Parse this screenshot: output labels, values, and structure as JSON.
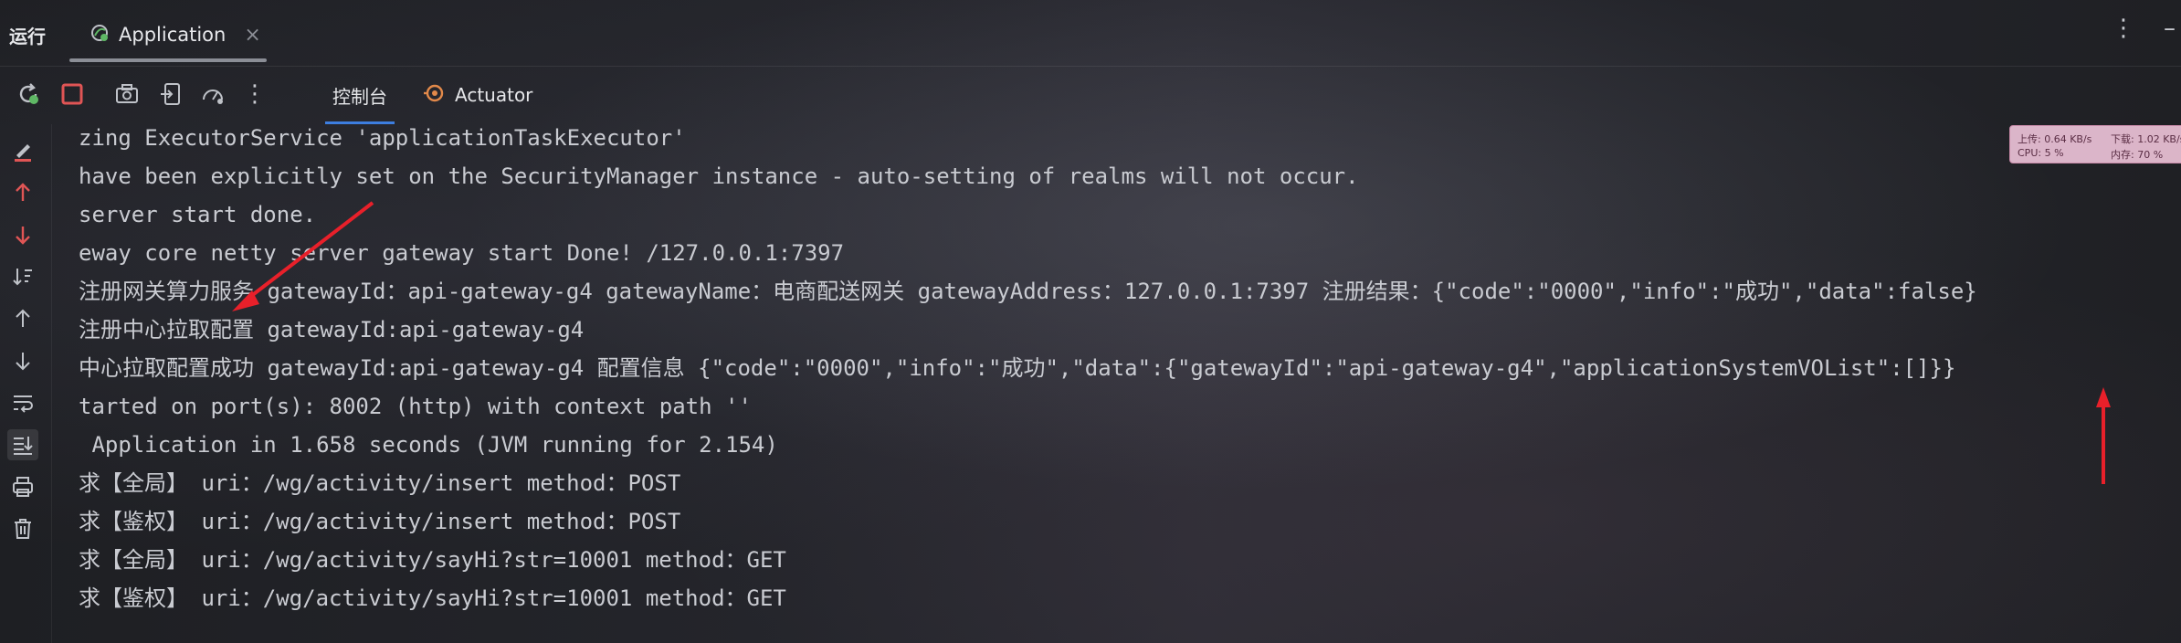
{
  "run_panel": {
    "title": "运行",
    "tab_label": "Application"
  },
  "toolbar": {
    "console_tab": "控制台",
    "actuator_tab": "Actuator"
  },
  "console": {
    "lines": [
      "zing ExecutorService 'applicationTaskExecutor'",
      "have been explicitly set on the SecurityManager instance - auto-setting of realms will not occur.",
      "server start done.",
      "eway core netty server gateway start Done! /127.0.0.1:7397",
      "注册网关算力服务 gatewayId：api-gateway-g4 gatewayName：电商配送网关 gatewayAddress：127.0.0.1:7397 注册结果：{\"code\":\"0000\",\"info\":\"成功\",\"data\":false}",
      "注册中心拉取配置 gatewayId:api-gateway-g4",
      "中心拉取配置成功 gatewayId:api-gateway-g4 配置信息 {\"code\":\"0000\",\"info\":\"成功\",\"data\":{\"gatewayId\":\"api-gateway-g4\",\"applicationSystemVOList\":[]}}",
      "tarted on port(s): 8002 (http) with context path ''",
      " Application in 1.658 seconds (JVM running for 2.154)",
      "求【全局】 uri：/wg/activity/insert method：POST",
      "求【鉴权】 uri：/wg/activity/insert method：POST",
      "求【全局】 uri：/wg/activity/sayHi?str=10001 method：GET",
      "求【鉴权】 uri：/wg/activity/sayHi?str=10001 method：GET"
    ]
  },
  "net_widget": {
    "upload": "上传: 0.64 KB/s",
    "download": "下载: 1.02 KB/s",
    "cpu": "CPU: 5 %",
    "memory": "内存: 70 %"
  },
  "colors": {
    "accent_blue": "#3d7ee0",
    "stop_red": "#e05555",
    "annotation_red": "#e8202a",
    "rerun_green": "#5fb865",
    "actuator_orange": "#e2894a"
  }
}
